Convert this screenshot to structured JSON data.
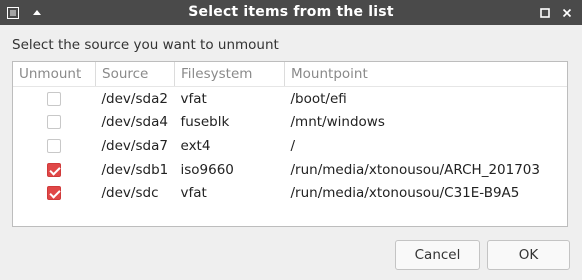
{
  "window": {
    "title": "Select items from the list",
    "menu_icon": "≡",
    "up_icon": "▲",
    "maximize_icon": "▢",
    "close_icon": "✕"
  },
  "prompt": "Select the source you want to unmount",
  "table": {
    "columns": [
      "Unmount",
      "Source",
      "Filesystem",
      "Mountpoint"
    ],
    "rows": [
      {
        "checked": false,
        "source": "/dev/sda2",
        "filesystem": "vfat",
        "mountpoint": "/boot/efi"
      },
      {
        "checked": false,
        "source": "/dev/sda4",
        "filesystem": "fuseblk",
        "mountpoint": "/mnt/windows"
      },
      {
        "checked": false,
        "source": "/dev/sda7",
        "filesystem": "ext4",
        "mountpoint": "/"
      },
      {
        "checked": true,
        "source": "/dev/sdb1",
        "filesystem": "iso9660",
        "mountpoint": "/run/media/xtonousou/ARCH_201703"
      },
      {
        "checked": true,
        "source": "/dev/sdc",
        "filesystem": "vfat",
        "mountpoint": "/run/media/xtonousou/C31E-B9A5"
      }
    ]
  },
  "buttons": {
    "cancel": "Cancel",
    "ok": "OK"
  },
  "colors": {
    "titlebar": "#4a4a4a",
    "checkbox_checked": "#e04747",
    "background": "#efefef"
  }
}
